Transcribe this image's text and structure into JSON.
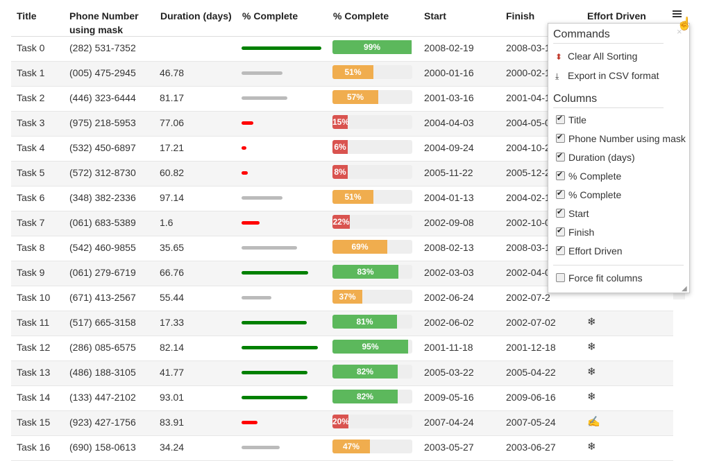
{
  "columns": {
    "title": "Title",
    "phone_line1": "Phone Number",
    "phone_line2": "using mask",
    "duration": "Duration (days)",
    "pct1": "% Complete",
    "pct2": "% Complete",
    "start": "Start",
    "finish": "Finish",
    "effort": "Effort Driven"
  },
  "rows": [
    {
      "title": "Task 0",
      "phone": "(282) 531-7352",
      "duration": "",
      "pct": 99,
      "pct_label": "99%",
      "start": "2008-02-19",
      "finish": "2008-03-1",
      "effort": ""
    },
    {
      "title": "Task 1",
      "phone": "(005) 475-2945",
      "duration": "46.78",
      "pct": 51,
      "pct_label": "51%",
      "start": "2000-01-16",
      "finish": "2000-02-1",
      "effort": ""
    },
    {
      "title": "Task 2",
      "phone": "(446) 323-6444",
      "duration": "81.17",
      "pct": 57,
      "pct_label": "57%",
      "start": "2001-03-16",
      "finish": "2001-04-1",
      "effort": ""
    },
    {
      "title": "Task 3",
      "phone": "(975) 218-5953",
      "duration": "77.06",
      "pct": 15,
      "pct_label": "15%",
      "start": "2004-04-03",
      "finish": "2004-05-0",
      "effort": ""
    },
    {
      "title": "Task 4",
      "phone": "(532) 450-6897",
      "duration": "17.21",
      "pct": 6,
      "pct_label": "6%",
      "start": "2004-09-24",
      "finish": "2004-10-2",
      "effort": ""
    },
    {
      "title": "Task 5",
      "phone": "(572) 312-8730",
      "duration": "60.82",
      "pct": 8,
      "pct_label": "8%",
      "start": "2005-11-22",
      "finish": "2005-12-2",
      "effort": ""
    },
    {
      "title": "Task 6",
      "phone": "(348) 382-2336",
      "duration": "97.14",
      "pct": 51,
      "pct_label": "51%",
      "start": "2004-01-13",
      "finish": "2004-02-1",
      "effort": ""
    },
    {
      "title": "Task 7",
      "phone": "(061) 683-5389",
      "duration": "1.6",
      "pct": 22,
      "pct_label": "22%",
      "start": "2002-09-08",
      "finish": "2002-10-0",
      "effort": ""
    },
    {
      "title": "Task 8",
      "phone": "(542) 460-9855",
      "duration": "35.65",
      "pct": 69,
      "pct_label": "69%",
      "start": "2008-02-13",
      "finish": "2008-03-1",
      "effort": ""
    },
    {
      "title": "Task 9",
      "phone": "(061) 279-6719",
      "duration": "66.76",
      "pct": 83,
      "pct_label": "83%",
      "start": "2002-03-03",
      "finish": "2002-04-0",
      "effort": ""
    },
    {
      "title": "Task 10",
      "phone": "(671) 413-2567",
      "duration": "55.44",
      "pct": 37,
      "pct_label": "37%",
      "start": "2002-06-24",
      "finish": "2002-07-2",
      "effort": ""
    },
    {
      "title": "Task 11",
      "phone": "(517) 665-3158",
      "duration": "17.33",
      "pct": 81,
      "pct_label": "81%",
      "start": "2002-06-02",
      "finish": "2002-07-02",
      "effort": "❄"
    },
    {
      "title": "Task 12",
      "phone": "(286) 085-6575",
      "duration": "82.14",
      "pct": 95,
      "pct_label": "95%",
      "start": "2001-11-18",
      "finish": "2001-12-18",
      "effort": "❄"
    },
    {
      "title": "Task 13",
      "phone": "(486) 188-3105",
      "duration": "41.77",
      "pct": 82,
      "pct_label": "82%",
      "start": "2005-03-22",
      "finish": "2005-04-22",
      "effort": "❄"
    },
    {
      "title": "Task 14",
      "phone": "(133) 447-2102",
      "duration": "93.01",
      "pct": 82,
      "pct_label": "82%",
      "start": "2009-05-16",
      "finish": "2009-06-16",
      "effort": "❄"
    },
    {
      "title": "Task 15",
      "phone": "(923) 427-1756",
      "duration": "83.91",
      "pct": 20,
      "pct_label": "20%",
      "start": "2007-04-24",
      "finish": "2007-05-24",
      "effort": "✍"
    },
    {
      "title": "Task 16",
      "phone": "(690) 158-0613",
      "duration": "34.24",
      "pct": 47,
      "pct_label": "47%",
      "start": "2003-05-27",
      "finish": "2003-06-27",
      "effort": "❄"
    }
  ],
  "colors": {
    "green": "#5cb85c",
    "orange": "#f0ad4e",
    "red": "#d9534f",
    "line_green": "#008000",
    "line_grey": "#bbbbbb",
    "line_red": "#ff0000"
  },
  "menu": {
    "commands_title": "Commands",
    "clear_sorting": "Clear All Sorting",
    "export_csv": "Export in CSV format",
    "columns_title": "Columns",
    "column_items": [
      {
        "label": "Title",
        "checked": true
      },
      {
        "label": "Phone Number using mask",
        "checked": true
      },
      {
        "label": "Duration (days)",
        "checked": true
      },
      {
        "label": "% Complete",
        "checked": true
      },
      {
        "label": "% Complete",
        "checked": true
      },
      {
        "label": "Start",
        "checked": true
      },
      {
        "label": "Finish",
        "checked": true
      },
      {
        "label": "Effort Driven",
        "checked": true
      }
    ],
    "force_fit": {
      "label": "Force fit columns",
      "checked": false
    },
    "close_glyph": "×"
  }
}
